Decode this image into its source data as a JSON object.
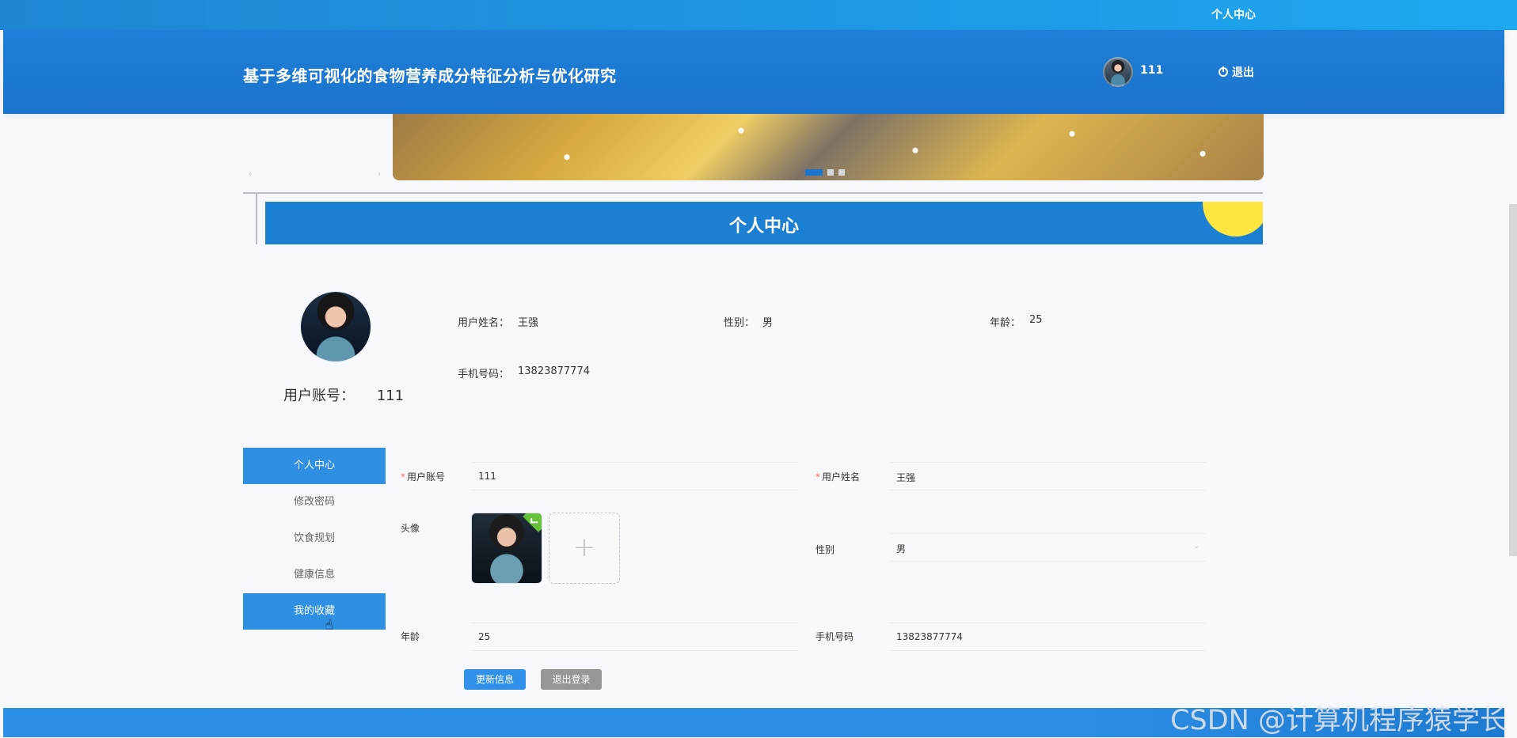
{
  "topbar": {
    "link": "个人中心"
  },
  "header": {
    "title": "基于多维可视化的食物营养成分特征分析与优化研究",
    "username": "111",
    "logout": "退出"
  },
  "section": {
    "title": "个人中心"
  },
  "profile": {
    "account_label": "用户账号：",
    "account_value": "111",
    "name_label": "用户姓名：",
    "name_value": "王强",
    "gender_label": "性别：",
    "gender_value": "男",
    "age_label": "年龄：",
    "age_value": "25",
    "phone_label": "手机号码：",
    "phone_value": "13823877774"
  },
  "menu": {
    "items": [
      {
        "label": "个人中心"
      },
      {
        "label": "修改密码"
      },
      {
        "label": "饮食规划"
      },
      {
        "label": "健康信息"
      },
      {
        "label": "我的收藏"
      }
    ]
  },
  "form": {
    "account_label": "用户账号",
    "account_value": "111",
    "name_label": "用户姓名",
    "name_value": "王强",
    "avatar_label": "头像",
    "gender_label": "性别",
    "gender_value": "男",
    "age_label": "年龄",
    "age_value": "25",
    "phone_label": "手机号码",
    "phone_value": "13823877774",
    "required_mark": "*",
    "upload_plus": "+"
  },
  "buttons": {
    "update": "更新信息",
    "logout": "退出登录"
  },
  "carousel": {
    "prev": "‹",
    "next": "›"
  },
  "watermark": "CSDN @计算机程序猿学长",
  "colors": {
    "primary": "#1b7fd2",
    "accent": "#ffe53f",
    "button_gray": "#969696"
  },
  "icons": {
    "power": "power-icon",
    "cursor": "cursor-icon",
    "check": "check-icon",
    "add": "plus-icon"
  }
}
